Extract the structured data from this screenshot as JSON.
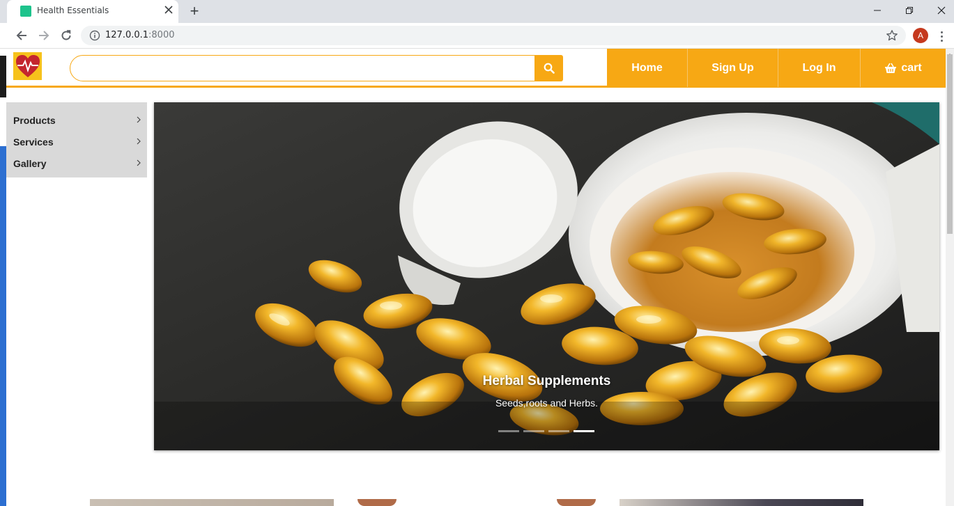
{
  "browser": {
    "tab_title": "Health Essentials",
    "new_tab_symbol": "+",
    "url_host": "127.0.0.1",
    "url_port": ":8000",
    "profile_initial": "A"
  },
  "site": {
    "search_placeholder": "",
    "nav": {
      "home": "Home",
      "signup": "Sign Up",
      "login": "Log In",
      "cart": "cart"
    },
    "menu": [
      {
        "label": "Products"
      },
      {
        "label": "Services"
      },
      {
        "label": "Gallery"
      }
    ],
    "carousel": {
      "title": "Herbal Supplements",
      "subtitle": "Seeds,roots and Herbs.",
      "slide_count": 4,
      "active_slide": 4
    }
  },
  "colors": {
    "brand_orange": "#f7a814",
    "logo_yellow": "#f6c21c",
    "menu_gray": "#d9d9d9"
  },
  "icons": {
    "search": "search-icon",
    "cart": "basket-icon",
    "menu_chevron": "chevron-right-icon"
  }
}
